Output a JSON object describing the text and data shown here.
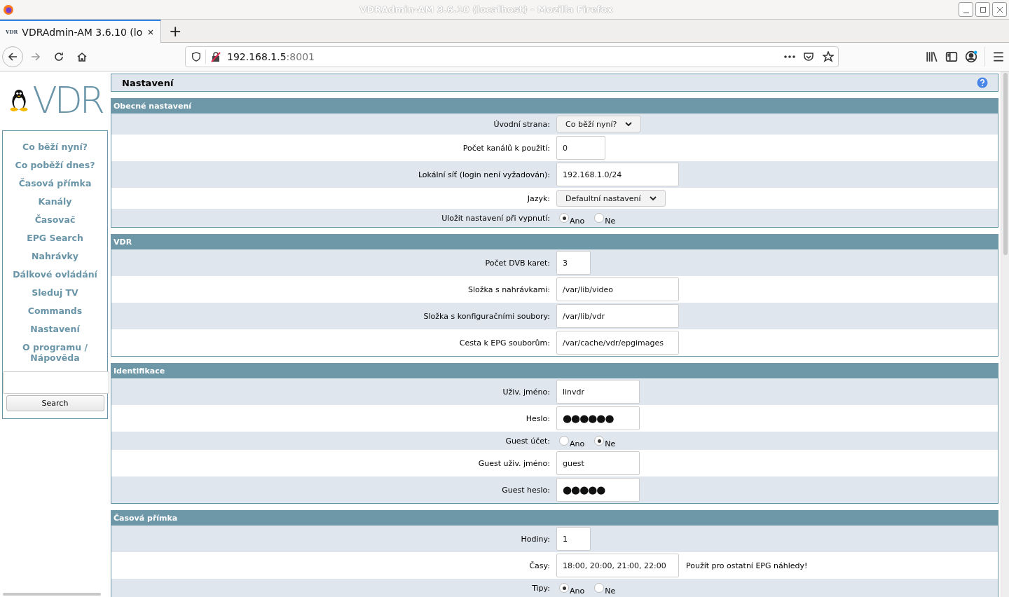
{
  "browser": {
    "window_title": "VDRAdmin-AM 3.6.10 (localhost) - Mozilla Firefox",
    "tabs": [
      {
        "title": "VDRAdmin-AM 3.6.10 (lo",
        "favicon": "VDR",
        "selected": true
      }
    ],
    "new_tab": "+",
    "url": {
      "host": "192.168.1.5",
      "port": ":8001"
    }
  },
  "sidebar": {
    "logo": "VDR",
    "nav": [
      {
        "label": "Co běží nyní?"
      },
      {
        "label": "Co poběží dnes?"
      },
      {
        "label": "Časová přímka"
      },
      {
        "label": "Kanály"
      },
      {
        "label": "Časovač"
      },
      {
        "label": "EPG Search"
      },
      {
        "label": "Nahrávky"
      },
      {
        "label": "Dálkové ovládání"
      },
      {
        "label": "Sleduj TV"
      },
      {
        "label": "Commands"
      },
      {
        "label": "Nastavení"
      },
      {
        "label": "O programu / Nápověda"
      }
    ],
    "search_button": "Search"
  },
  "page": {
    "title": "Nastavení",
    "sections": [
      {
        "title": "Obecné nastavení",
        "rows": [
          {
            "label": "Úvodní strana:",
            "kind": "select",
            "value": "Co běží nyní?"
          },
          {
            "label": "Počet kanálů k použití:",
            "kind": "input",
            "value": "0"
          },
          {
            "label": "Lokální síť (login není vyžadován):",
            "kind": "input",
            "value": "192.168.1.0/24"
          },
          {
            "label": "Jazyk:",
            "kind": "select",
            "value": "Defaultní nastavení"
          },
          {
            "label": "Uložit nastavení při vypnutí:",
            "kind": "radio",
            "options": [
              {
                "label": "Ano",
                "selected": true
              },
              {
                "label": "Ne",
                "selected": false
              }
            ]
          }
        ]
      },
      {
        "title": "VDR",
        "rows": [
          {
            "label": "Počet DVB karet:",
            "kind": "input",
            "value": "3"
          },
          {
            "label": "Složka s nahrávkami:",
            "kind": "input",
            "value": "/var/lib/video"
          },
          {
            "label": "Složka s konfiguračními soubory:",
            "kind": "input",
            "value": "/var/lib/vdr"
          },
          {
            "label": "Cesta k EPG souborům:",
            "kind": "input",
            "value": "/var/cache/vdr/epgimages"
          }
        ]
      },
      {
        "title": "Identifikace",
        "rows": [
          {
            "label": "Uživ. jméno:",
            "kind": "input",
            "value": "linvdr"
          },
          {
            "label": "Heslo:",
            "kind": "password",
            "value": "●●●●●●"
          },
          {
            "label": "Guest účet:",
            "kind": "radio",
            "options": [
              {
                "label": "Ano",
                "selected": false
              },
              {
                "label": "Ne",
                "selected": true
              }
            ]
          },
          {
            "label": "Guest uživ. jméno:",
            "kind": "input",
            "value": "guest"
          },
          {
            "label": "Guest heslo:",
            "kind": "password",
            "value": "●●●●●"
          }
        ]
      },
      {
        "title": "Časová přímka",
        "rows": [
          {
            "label": "Hodiny:",
            "kind": "input",
            "value": "1"
          },
          {
            "label": "Časy:",
            "kind": "input",
            "value": "18:00, 20:00, 21:00, 22:00",
            "note": "Použít pro ostatní EPG náhledy!"
          },
          {
            "label": "Tipy:",
            "kind": "radio",
            "options": [
              {
                "label": "Ano",
                "selected": true
              },
              {
                "label": "Ne",
                "selected": false
              }
            ]
          }
        ]
      }
    ]
  }
}
